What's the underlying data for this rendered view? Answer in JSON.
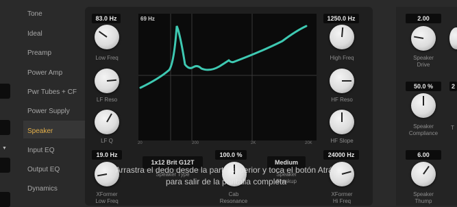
{
  "sidebar": {
    "items": [
      {
        "label": "Tone"
      },
      {
        "label": "Ideal"
      },
      {
        "label": "Preamp"
      },
      {
        "label": "Power Amp"
      },
      {
        "label": "Pwr Tubes + CF"
      },
      {
        "label": "Power Supply"
      },
      {
        "label": "Speaker",
        "active": true
      },
      {
        "label": "Input EQ"
      },
      {
        "label": "Output EQ"
      },
      {
        "label": "Dynamics"
      }
    ],
    "accent_color": "#e4b04a"
  },
  "lf": {
    "low_freq": {
      "value": "83.0 Hz",
      "label": "Low Freq"
    },
    "lf_reso": {
      "label": "LF Reso"
    },
    "lf_q": {
      "label": "LF Q"
    }
  },
  "hf": {
    "high_freq": {
      "value": "1250.0 Hz",
      "label": "High Freq"
    },
    "hf_reso": {
      "label": "HF Reso"
    },
    "hf_slope": {
      "label": "HF Slope"
    }
  },
  "graph": {
    "title": "69 Hz",
    "x_ticks": [
      "20",
      "200",
      "2K",
      "20K"
    ],
    "curve_color": "#3ec9b2"
  },
  "bottom": {
    "xformer_low": {
      "value": "19.0 Hz",
      "label_1": "XFormer",
      "label_2": "Low Freq"
    },
    "speaker_type": {
      "value": "1x12 Brit G12T",
      "label": "Speaker Type"
    },
    "cab_resonance": {
      "value": "100.0 %",
      "label_1": "Cab",
      "label_2": "Resonance"
    },
    "speaker_breakup": {
      "value": "Medium",
      "label_1": "Speaker",
      "label_2": "Breakup"
    },
    "xformer_high": {
      "value": "24000 Hz",
      "label_1": "XFormer",
      "label_2": "Hi Freq"
    }
  },
  "right": {
    "speaker_drive": {
      "value": "2.00",
      "label_1": "Speaker",
      "label_2": "Drive"
    },
    "speaker_compliance": {
      "value": "50.0 %",
      "label_1": "Speaker",
      "label_2": "Compliance"
    },
    "speaker_thump": {
      "value": "6.00",
      "label_1": "Speaker",
      "label_2": "Thump"
    },
    "cut_box": {
      "value": "2"
    },
    "cut_label": {
      "value": "T"
    }
  },
  "toast": {
    "line1": "Arrastra el dedo desde la parte superior y toca el botón Atrás",
    "line2": "para salir de la pantalla completa"
  }
}
